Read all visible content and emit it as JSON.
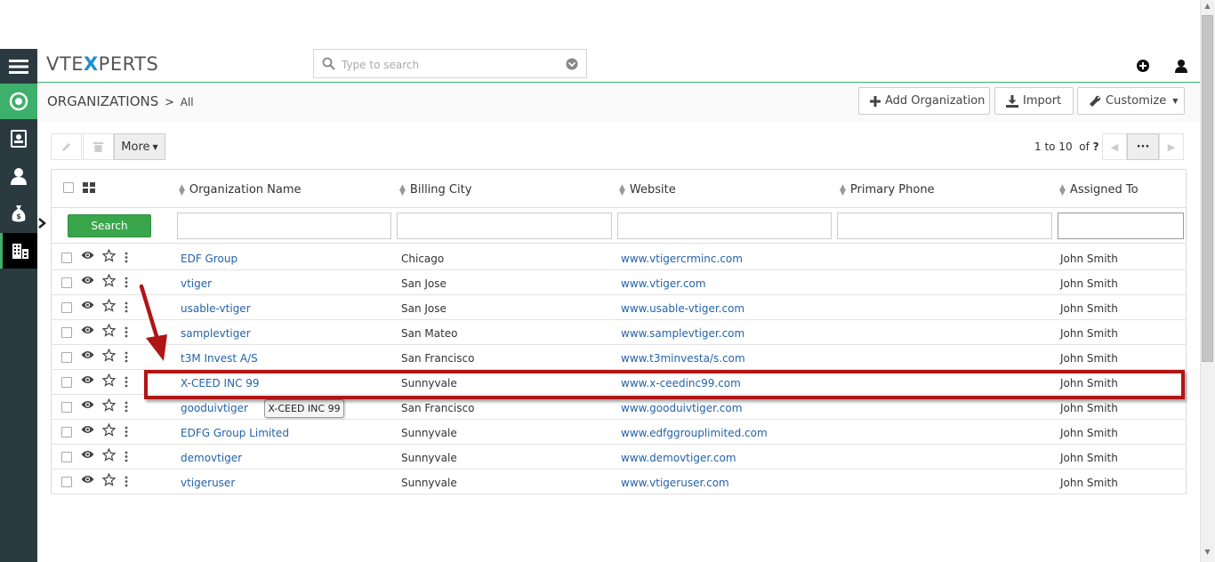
{
  "app": {
    "logo_prefix": "VTE",
    "logo_x": "X",
    "logo_suffix": "PERTS"
  },
  "search": {
    "placeholder": "Type to search"
  },
  "breadcrumb": {
    "module": "ORGANIZATIONS",
    "separator": ">",
    "view": "All"
  },
  "actions": {
    "add": "Add Organization",
    "import": "Import",
    "customize": "Customize"
  },
  "toolbar": {
    "more": "More"
  },
  "pager": {
    "range": "1 to 10",
    "of": "of",
    "total": "?",
    "dots": "···"
  },
  "table": {
    "columns": [
      "Organization Name",
      "Billing City",
      "Website",
      "Primary Phone",
      "Assigned To"
    ],
    "search_button": "Search",
    "rows": [
      {
        "name": "EDF Group",
        "city": "Chicago",
        "website": "www.vtigercrminc.com",
        "phone": "",
        "assigned": "John Smith"
      },
      {
        "name": "vtiger",
        "city": "San Jose",
        "website": "www.vtiger.com",
        "phone": "",
        "assigned": "John Smith"
      },
      {
        "name": "usable-vtiger",
        "city": "San Jose",
        "website": "www.usable-vtiger.com",
        "phone": "",
        "assigned": "John Smith"
      },
      {
        "name": "samplevtiger",
        "city": "San Mateo",
        "website": "www.samplevtiger.com",
        "phone": "",
        "assigned": "John Smith"
      },
      {
        "name": "t3M Invest A/S",
        "city": "San Francisco",
        "website": "www.t3minvesta/s.com",
        "phone": "",
        "assigned": "John Smith"
      },
      {
        "name": "X-CEED INC 99",
        "city": "Sunnyvale",
        "website": "www.x-ceedinc99.com",
        "phone": "",
        "assigned": "John Smith"
      },
      {
        "name": "gooduivtiger",
        "city": "San Francisco",
        "website": "www.gooduivtiger.com",
        "phone": "",
        "assigned": "John Smith"
      },
      {
        "name": "EDFG Group Limited",
        "city": "Sunnyvale",
        "website": "www.edfggrouplimited.com",
        "phone": "",
        "assigned": "John Smith"
      },
      {
        "name": "demovtiger",
        "city": "Sunnyvale",
        "website": "www.demovtiger.com",
        "phone": "",
        "assigned": "John Smith"
      },
      {
        "name": "vtigeruser",
        "city": "Sunnyvale",
        "website": "www.vtigeruser.com",
        "phone": "",
        "assigned": "John Smith"
      }
    ]
  },
  "tooltip": {
    "text": "X-CEED INC 99"
  },
  "colors": {
    "accent": "#3db06b",
    "link": "#2563a8",
    "highlight": "#b01515",
    "sidebar": "#2a3a40"
  },
  "icons": [
    "menu-icon",
    "home-icon",
    "contacts-icon",
    "user-icon",
    "money-bag-icon",
    "organization-icon",
    "search-icon",
    "chevron-down-icon",
    "plus-circle-icon",
    "user-account-icon",
    "pencil-icon",
    "trash-icon",
    "eye-icon",
    "star-icon",
    "kebab-icon",
    "grid-icon"
  ]
}
